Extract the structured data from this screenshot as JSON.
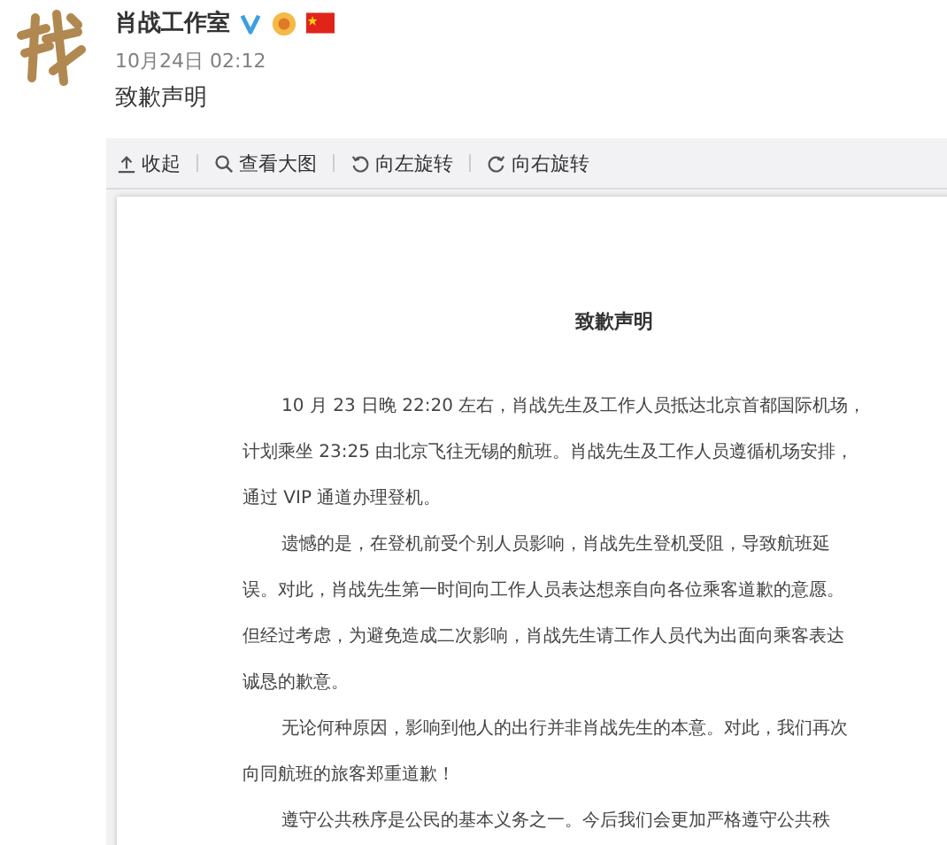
{
  "post": {
    "author": "肖战工作室",
    "time": "10月24日 02:12",
    "text": "致歉声明"
  },
  "toolbar": [
    {
      "kind": "collapse",
      "label": "收起"
    },
    {
      "kind": "zoom",
      "label": "查看大图"
    },
    {
      "kind": "rotate-left",
      "label": "向左旋转"
    },
    {
      "kind": "rotate-right",
      "label": "向右旋转"
    }
  ],
  "document": {
    "title": "致歉声明",
    "paragraphs": [
      {
        "lines": [
          "10 月 23 日晚 22:20 左右，肖战先生及工作人员抵达北京首都国际机场，",
          "计划乘坐 23:25 由北京飞往无锡的航班。肖战先生及工作人员遵循机场安排，",
          "通过 VIP 通道办理登机。"
        ]
      },
      {
        "lines": [
          "遗憾的是，在登机前受个别人员影响，肖战先生登机受阻，导致航班延",
          "误。对此，肖战先生第一时间向工作人员表达想亲自向各位乘客道歉的意愿。",
          "但经过考虑，为避免造成二次影响，肖战先生请工作人员代为出面向乘客表达",
          "诚恳的歉意。"
        ]
      },
      {
        "lines": [
          "无论何种原因，影响到他人的出行并非肖战先生的本意。对此，我们再次",
          "向同航班的旅客郑重道歉！"
        ]
      },
      {
        "lines": [
          "遵守公共秩序是公民的基本义务之一。今后我们会更加严格遵守公共秩"
        ]
      }
    ]
  }
}
